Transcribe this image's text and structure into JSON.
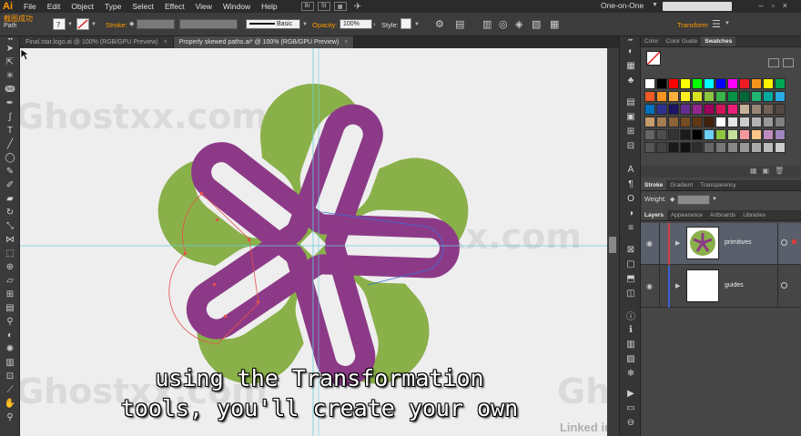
{
  "app": {
    "logo": "Ai",
    "menu": [
      "File",
      "Edit",
      "Object",
      "Type",
      "Select",
      "Effect",
      "View",
      "Window",
      "Help"
    ],
    "bridge_button": "Br",
    "stock_button": "St",
    "workspace": "One-on-One"
  },
  "control_bar": {
    "context_title": "截图成功",
    "context_sub": "Path",
    "stroke_label": "Stroke:",
    "brush_value": "Basic",
    "opacity_label": "Opacity:",
    "opacity_value": "100%",
    "style_label": "Style:",
    "transform_label": "Transform"
  },
  "tabs": [
    {
      "label": "Final.star.logo.ai @ 100% (RGB/GPU Preview)",
      "close": "×",
      "active": false
    },
    {
      "label": "Properly skewed paths.ai* @ 100% (RGB/GPU Preview)",
      "close": "×",
      "active": true
    }
  ],
  "canvas": {
    "watermark_text": "Ghostxx.com",
    "watermark_text_short": "Ghos",
    "subtitle_line1": "using the Transformation",
    "subtitle_line2": "tools, you'll create your own",
    "brand": "Linked in",
    "colors": {
      "green": "#8ab04a",
      "purple": "#8c3a87",
      "guide": "#66d0e0",
      "selection": "#e8504a",
      "selection_blue": "#3a6fd8"
    }
  },
  "swatches_panel": {
    "tabs": [
      "Color",
      "Color Guide",
      "Swatches"
    ],
    "active_tab": "Swatches"
  },
  "stroke_panel": {
    "tabs": [
      "Stroke",
      "Gradient",
      "Transparency"
    ],
    "weight_label": "Weight:"
  },
  "layers_panel": {
    "tabs": [
      "Layers",
      "Appearance",
      "Artboards",
      "Libraries"
    ],
    "layers": [
      {
        "name": "primitives",
        "selected": true,
        "color": "#d04040"
      },
      {
        "name": "guides",
        "selected": false,
        "color": "#3a60d0"
      }
    ]
  }
}
